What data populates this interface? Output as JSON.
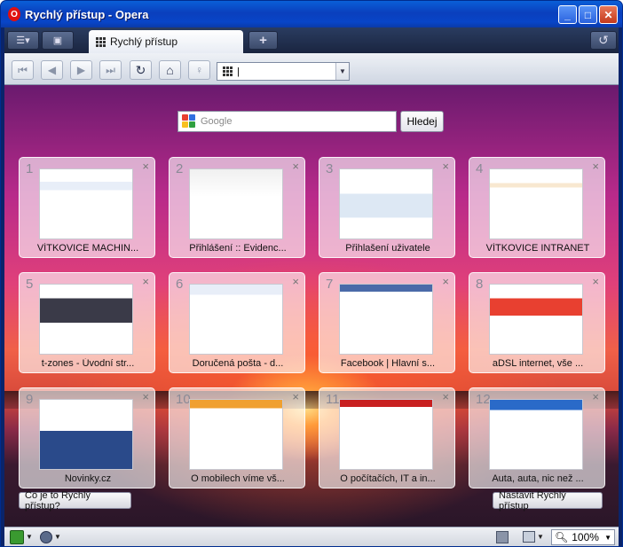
{
  "window": {
    "title": "Rychlý přístup - Opera",
    "minimize_glyph": "_",
    "maximize_glyph": "□",
    "close_glyph": "✕"
  },
  "tabbar": {
    "menu_glyph": "☰▾",
    "panel_glyph": "▣",
    "active_tab_label": "Rychlý přístup",
    "new_tab_glyph": "+",
    "closed_tabs_glyph": "↺"
  },
  "toolbar": {
    "rewind_glyph": "⏮",
    "back_glyph": "◀",
    "forward_glyph": "▶",
    "fastforward_glyph": "⏭",
    "reload_glyph": "↻",
    "home_glyph": "⌂",
    "wand_glyph": "♀",
    "address_value": "|",
    "address_dropdown_glyph": "▼"
  },
  "search": {
    "placeholder": "Google",
    "button_label": "Hledej"
  },
  "speed_dial": {
    "close_glyph": "×",
    "tiles": [
      {
        "num": "1",
        "label": "VÍTKOVICE MACHIN..."
      },
      {
        "num": "2",
        "label": "Přihlášení :: Evidenc..."
      },
      {
        "num": "3",
        "label": "Přihlašení uživatele"
      },
      {
        "num": "4",
        "label": "VÍTKOVICE INTRANET"
      },
      {
        "num": "5",
        "label": "t-zones - Úvodní str..."
      },
      {
        "num": "6",
        "label": "Doručená pošta - d..."
      },
      {
        "num": "7",
        "label": "Facebook | Hlavní s..."
      },
      {
        "num": "8",
        "label": "aDSL internet, vše ..."
      },
      {
        "num": "9",
        "label": "Novinky.cz"
      },
      {
        "num": "10",
        "label": "O mobilech víme vš..."
      },
      {
        "num": "11",
        "label": "O počítačích, IT a in..."
      },
      {
        "num": "12",
        "label": "Auta, auta, nic než ..."
      }
    ],
    "help_button": "Co je to Rychlý přístup?",
    "configure_button": "Nastavit Rychlý přístup"
  },
  "statusbar": {
    "zoom": "100%",
    "zoom_dropdown_glyph": "▼"
  },
  "colors": {
    "titlebar": "#0a5fd8",
    "tab_bg": "#ffffff",
    "sky_top": "#6a1a6e",
    "sunset": "#f06048"
  }
}
